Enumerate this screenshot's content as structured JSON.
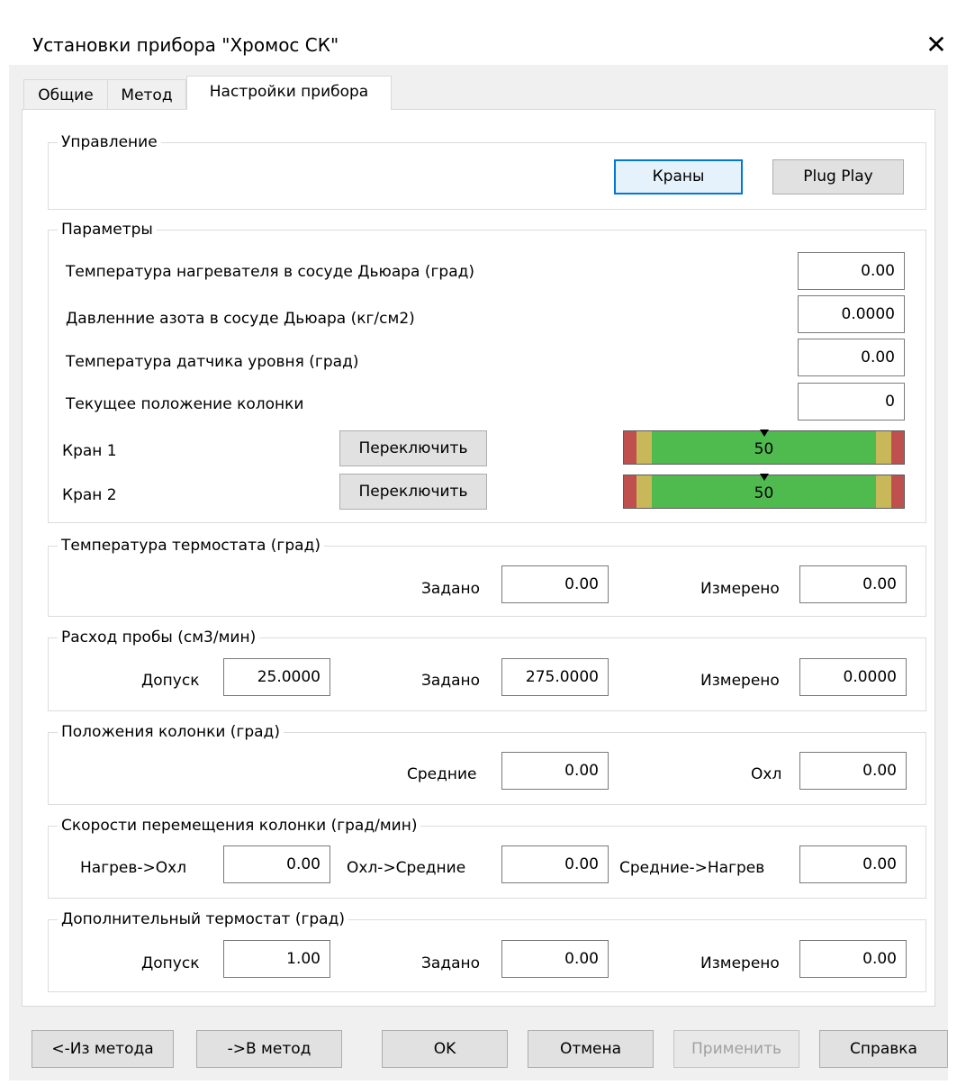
{
  "window": {
    "title": "Установки прибора \"Хромос СК\"",
    "close_glyph": "✕"
  },
  "tabs": [
    {
      "label": "Общие",
      "active": false
    },
    {
      "label": "Метод",
      "active": false
    },
    {
      "label": "Настройки прибора",
      "active": true
    }
  ],
  "control": {
    "legend": "Управление",
    "valves_button": "Краны",
    "plugplay_button": "Plug  Play"
  },
  "params": {
    "legend": "Параметры",
    "rows": [
      {
        "label": "Температура нагревателя в сосуде Дьюара (град)",
        "value": "0.00"
      },
      {
        "label": "Давленние азота в сосуде Дьюара (кг/см2)",
        "value": "0.0000"
      },
      {
        "label": "Температура датчика уровня (град)",
        "value": "0.00"
      },
      {
        "label": "Текущее положение колонки",
        "value": "0"
      }
    ],
    "valves": [
      {
        "label": "Кран 1",
        "button": "Переключить",
        "gauge_value": "50"
      },
      {
        "label": "Кран 2",
        "button": "Переключить",
        "gauge_value": "50"
      }
    ],
    "gauge_colors": {
      "red": "#c0504d",
      "yellow": "#c9b85a",
      "green": "#4fbb4f"
    }
  },
  "thermostat": {
    "legend": "Температура термостата (град)",
    "set_label": "Задано",
    "set_value": "0.00",
    "meas_label": "Измерено",
    "meas_value": "0.00"
  },
  "flow": {
    "legend": "Расход пробы (см3/мин)",
    "tol_label": "Допуск",
    "tol_value": "25.0000",
    "set_label": "Задано",
    "set_value": "275.0000",
    "meas_label": "Измерено",
    "meas_value": "0.0000"
  },
  "column_pos": {
    "legend": "Положения колонки (град)",
    "mid_label": "Средние",
    "mid_value": "0.00",
    "cool_label": "Охл",
    "cool_value": "0.00"
  },
  "speeds": {
    "legend": "Скорости перемещения колонки (град/мин)",
    "a_label": "Нагрев->Охл",
    "a_value": "0.00",
    "b_label": "Охл->Средние",
    "b_value": "0.00",
    "c_label": "Средние->Нагрев",
    "c_value": "0.00"
  },
  "extra_thermo": {
    "legend": "Дополнительный термостат (град)",
    "tol_label": "Допуск",
    "tol_value": "1.00",
    "set_label": "Задано",
    "set_value": "0.00",
    "meas_label": "Измерено",
    "meas_value": "0.00"
  },
  "footer": {
    "from_method": "<-Из метода",
    "to_method": "->В метод",
    "ok": "OK",
    "cancel": "Отмена",
    "apply": "Применить",
    "help": "Справка"
  }
}
